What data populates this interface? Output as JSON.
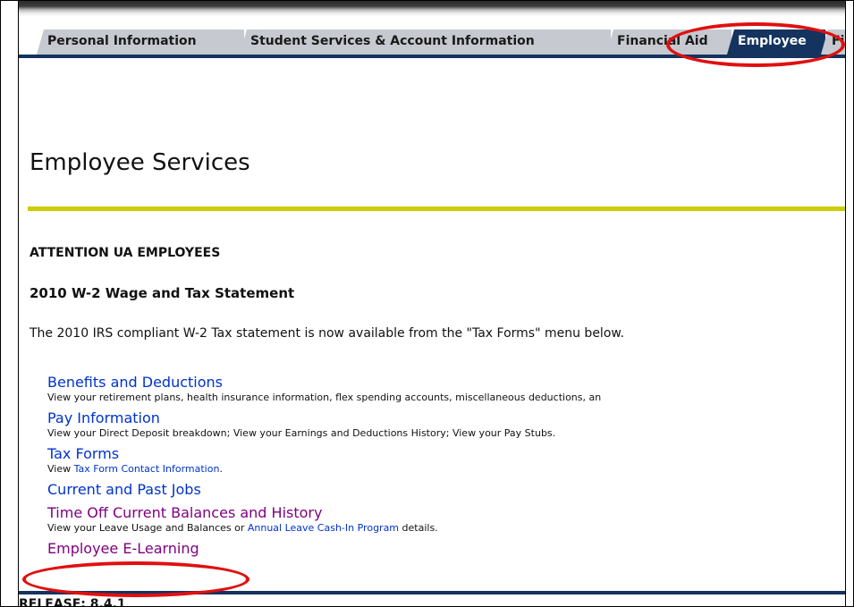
{
  "tabs": [
    {
      "label": "Personal Information",
      "active": false
    },
    {
      "label": "Student Services & Account Information",
      "active": false
    },
    {
      "label": "Financial Aid",
      "active": false
    },
    {
      "label": "Employee",
      "active": true
    },
    {
      "label": "Fi",
      "active": false
    }
  ],
  "page": {
    "title": "Employee Services"
  },
  "notice": {
    "heading": "ATTENTION UA EMPLOYEES",
    "subheading": "2010 W-2 Wage and Tax Statement",
    "body": "The 2010 IRS compliant W-2 Tax statement is now available from the \"Tax Forms\" menu below."
  },
  "menu": {
    "benefits": {
      "label": "Benefits and Deductions",
      "desc": "View your retirement plans, health insurance information, flex spending accounts, miscellaneous deductions, an"
    },
    "pay": {
      "label": "Pay Information",
      "desc": "View your Direct Deposit breakdown; View your Earnings and Deductions History; View your Pay Stubs."
    },
    "tax": {
      "label": "Tax Forms",
      "desc_prefix": "View ",
      "desc_link": "Tax Form Contact Information",
      "desc_suffix": "."
    },
    "jobs": {
      "label": "Current and Past Jobs"
    },
    "timeoff": {
      "label": "Time Off Current Balances and History",
      "desc_prefix": "View your Leave Usage and Balances or ",
      "desc_link": "Annual Leave Cash-In Program",
      "desc_suffix": " details."
    },
    "elearning": {
      "label": "Employee E-Learning"
    }
  },
  "footer": {
    "release": "RELEASE: 8.4.1"
  },
  "colors": {
    "tab_active": "#14335f",
    "tab_inactive": "#c6c9cf",
    "link": "#0033cc",
    "visited": "#800080",
    "rule": "#cccc00",
    "highlight": "#e01010"
  }
}
